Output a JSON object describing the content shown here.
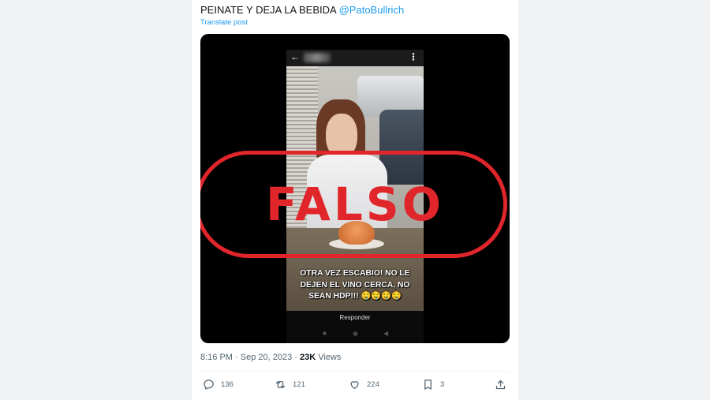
{
  "tweet": {
    "text": "PEINATE Y DEJA LA BEBIDA",
    "mention": "@PatoBullrich",
    "translate_label": "Translate post"
  },
  "media": {
    "stamp": "FALSO",
    "caption_lines": [
      "OTRA VEZ ESCABIO! NO LE",
      "DEJEN EL VINO CERCA, NO",
      "SEAN HDP!!! 🤤🤤🤤🤤"
    ],
    "reply_label": "Responder"
  },
  "meta": {
    "timestamp": "8:16 PM · Sep 20, 2023 · ",
    "views_count": "23K",
    "views_label": " Views"
  },
  "actions": {
    "replies": "136",
    "reposts": "121",
    "likes": "224",
    "bookmarks": "3"
  },
  "colors": {
    "accent": "#1d9bf0",
    "stamp": "#e0262b"
  }
}
